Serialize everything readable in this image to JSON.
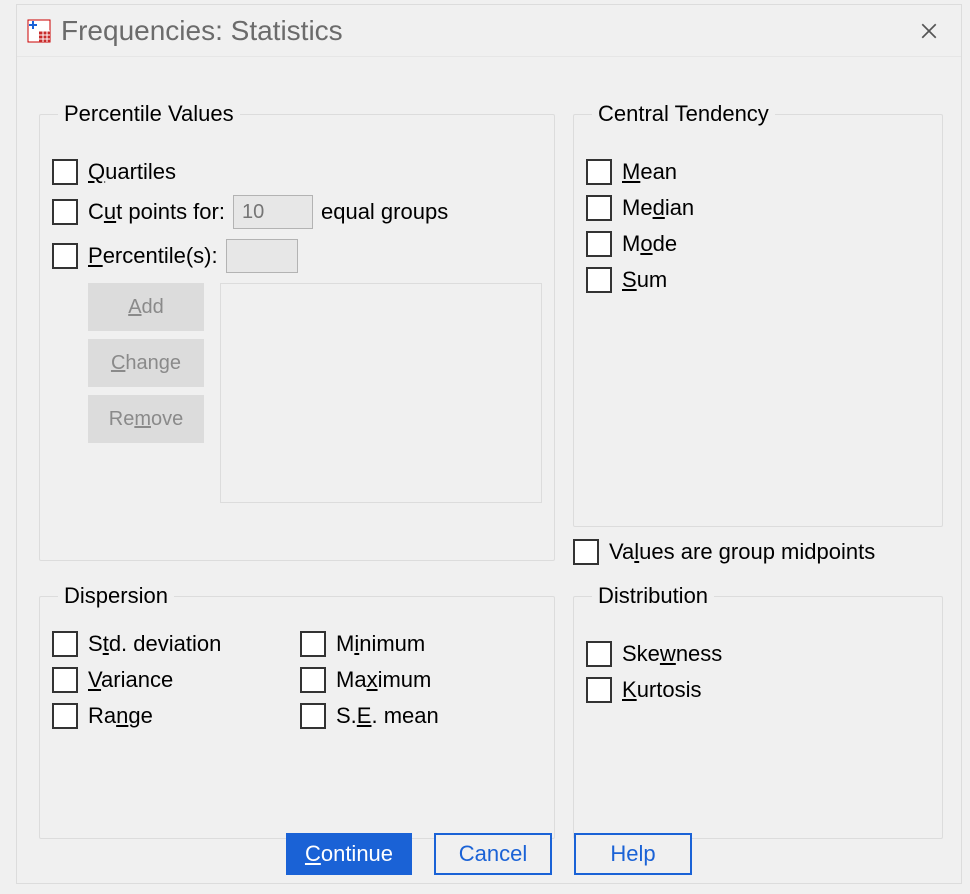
{
  "window": {
    "title": "Frequencies: Statistics"
  },
  "groups": {
    "percentile": {
      "legend": "Percentile Values",
      "quartiles": "Quartiles",
      "cut_prefix": "Cut points for:",
      "cut_value": "10",
      "cut_suffix": "equal groups",
      "percentiles": "Percentile(s):",
      "add": "Add",
      "change": "Change",
      "remove": "Remove"
    },
    "ct": {
      "legend": "Central Tendency",
      "mean": "Mean",
      "median": "Median",
      "mode": "Mode",
      "sum": "Sum"
    },
    "midpoints": "Values are group midpoints",
    "dispersion": {
      "legend": "Dispersion",
      "std": "Std. deviation",
      "min": "Minimum",
      "var": "Variance",
      "max": "Maximum",
      "range": "Range",
      "se": "S.E. mean"
    },
    "dist": {
      "legend": "Distribution",
      "skew": "Skewness",
      "kurt": "Kurtosis"
    }
  },
  "buttons": {
    "continue": "Continue",
    "cancel": "Cancel",
    "help": "Help"
  }
}
